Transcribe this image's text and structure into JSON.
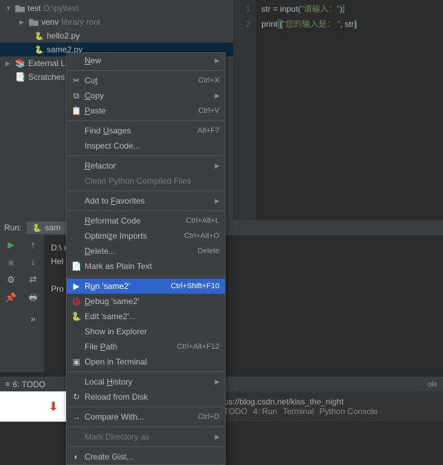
{
  "sidebar": {
    "project": {
      "name": "test",
      "path": "D:\\py\\test"
    },
    "venv": {
      "name": "venv",
      "hint": "library root"
    },
    "files": [
      "hello2.py",
      "same2.py"
    ],
    "external": "External L",
    "scratches": "Scratches"
  },
  "editor": {
    "lines": [
      {
        "num": "1",
        "tokens": [
          {
            "t": "str",
            "c": "fn"
          },
          {
            "t": " = ",
            "c": "pn"
          },
          {
            "t": "input",
            "c": "fn"
          },
          {
            "t": "(",
            "c": "pn"
          },
          {
            "t": "\"请输入：\"",
            "c": "str"
          },
          {
            "t": ")",
            "c": "pn"
          },
          {
            "t": ";",
            "c": "pn hl"
          }
        ]
      },
      {
        "num": "2",
        "tokens": [
          {
            "t": "print",
            "c": "fn"
          },
          {
            "t": " (",
            "c": "pn hl"
          },
          {
            "t": "\"您的输入是：  \"",
            "c": "str"
          },
          {
            "t": ", ",
            "c": "pn"
          },
          {
            "t": "str",
            "c": "fn"
          },
          {
            "t": ")",
            "c": "pn hl"
          }
        ]
      }
    ]
  },
  "run": {
    "label": "Run:",
    "tab": "sam",
    "output_lines": [
      "D:\\                                      xe D:/py/test/hello2.py",
      "Hel",
      "",
      "Pro                                       0"
    ]
  },
  "menu": [
    {
      "type": "item",
      "icon": "",
      "label": "New",
      "u": "N",
      "arrow": true
    },
    {
      "type": "sep"
    },
    {
      "type": "item",
      "icon": "✂",
      "label": "Cut",
      "u": "t",
      "short": "Ctrl+X"
    },
    {
      "type": "item",
      "icon": "⧉",
      "label": "Copy",
      "u": "C",
      "arrow": true
    },
    {
      "type": "item",
      "icon": "📋",
      "label": "Paste",
      "u": "P",
      "short": "Ctrl+V"
    },
    {
      "type": "sep"
    },
    {
      "type": "item",
      "label": "Find Usages",
      "u": "U",
      "short": "Alt+F7"
    },
    {
      "type": "item",
      "label": "Inspect Code..."
    },
    {
      "type": "sep"
    },
    {
      "type": "item",
      "label": "Refactor",
      "u": "R",
      "arrow": true
    },
    {
      "type": "item",
      "label": "Clean Python Compiled Files",
      "disabled": true
    },
    {
      "type": "sep"
    },
    {
      "type": "item",
      "label": "Add to Favorites",
      "u": "F",
      "arrow": true
    },
    {
      "type": "sep"
    },
    {
      "type": "item",
      "label": "Reformat Code",
      "u": "R",
      "short": "Ctrl+Alt+L"
    },
    {
      "type": "item",
      "label": "Optimize Imports",
      "u": "z",
      "short": "Ctrl+Alt+O"
    },
    {
      "type": "item",
      "label": "Delete...",
      "u": "D",
      "short": "Delete"
    },
    {
      "type": "item",
      "icon": "📄",
      "label": "Mark as Plain Text"
    },
    {
      "type": "sep"
    },
    {
      "type": "item",
      "icon": "▶",
      "label": "Run 'same2'",
      "u": "u",
      "short": "Ctrl+Shift+F10",
      "hover": true
    },
    {
      "type": "item",
      "icon": "🐞",
      "label": "Debug 'same2'",
      "u": "D"
    },
    {
      "type": "item",
      "icon": "🐍",
      "label": "Edit 'same2'..."
    },
    {
      "type": "item",
      "label": "Show in Explorer"
    },
    {
      "type": "item",
      "label": "File Path",
      "u": "P",
      "short": "Ctrl+Alt+F12"
    },
    {
      "type": "item",
      "icon": "▣",
      "label": "Open in Terminal"
    },
    {
      "type": "sep"
    },
    {
      "type": "item",
      "label": "Local History",
      "u": "H",
      "arrow": true
    },
    {
      "type": "item",
      "icon": "↻",
      "label": "Reload from Disk"
    },
    {
      "type": "sep"
    },
    {
      "type": "item",
      "icon": "→",
      "label": "Compare With...",
      "u": "",
      "short": "Ctrl+D"
    },
    {
      "type": "sep"
    },
    {
      "type": "item",
      "label": "Mark Directory as",
      "disabled": true,
      "arrow": true
    },
    {
      "type": "sep"
    },
    {
      "type": "item",
      "icon": "◐",
      "label": "Create Gist..."
    }
  ],
  "status": {
    "todo": "6: TODO",
    "terminal": "Terminal",
    "python_console": "Python Console",
    "run_tab": "4: Run",
    "todo2": "6: TODO",
    "ole": "ole"
  },
  "watermark": "https://blog.csdn.net/kiss_the_night"
}
